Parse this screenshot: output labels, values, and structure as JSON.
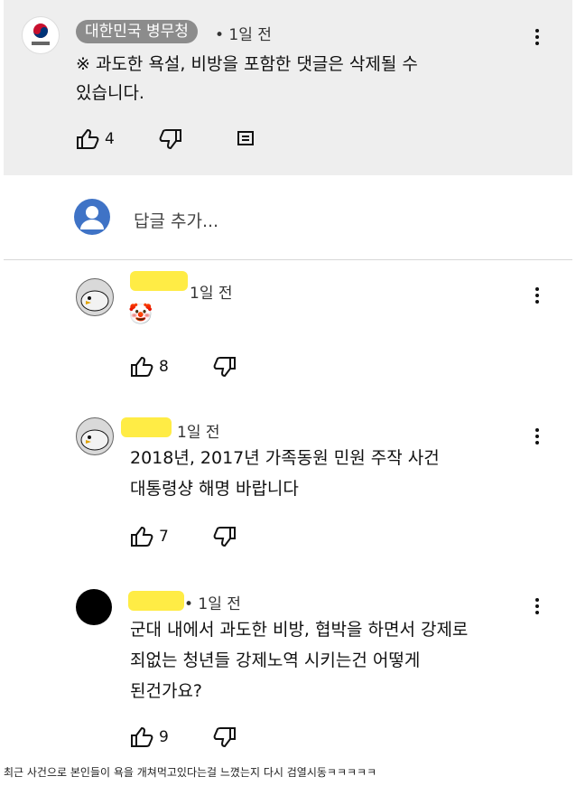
{
  "pinned": {
    "author": "대한민국 병무청",
    "time": "• 1일 전",
    "text_line1": "※ 과도한 욕설, 비방을 포함한 댓글은 삭제될 수",
    "text_line2": "있습니다.",
    "likes": "4"
  },
  "reply_box": {
    "placeholder": "답글 추가..."
  },
  "replies": [
    {
      "time": "1일 전",
      "emoji": "🤡",
      "text_line1": "",
      "text_line2": "",
      "likes": "8"
    },
    {
      "time": "1일 전",
      "text_line1": "2018년, 2017년 가족동원 민원 주작 사건",
      "text_line2": "대통령샹 해명 바랍니다",
      "likes": "7"
    },
    {
      "time": "• 1일 전",
      "text_line1": "군대 내에서 과도한 비방, 협박을 하면서 강제로",
      "text_line2": "죄없는 청년들 강제노역 시키는건 어떻게",
      "text_line3": "된건가요?",
      "likes": "9"
    }
  ],
  "caption": "최근 사건으로 본인들이 욕을 개쳐먹고있다는걸 느꼈는지 다시 검열시동ㅋㅋㅋㅋㅋ",
  "colors": {
    "pinned_bg": "#eeeeee",
    "tag_bg": "#8c8c8c",
    "reply_avatar": "#3f73c6",
    "redaction": "#ffeb3b"
  },
  "icons": [
    "like-icon",
    "dislike-icon",
    "reply-icon",
    "more-icon",
    "user-avatar-icon"
  ]
}
